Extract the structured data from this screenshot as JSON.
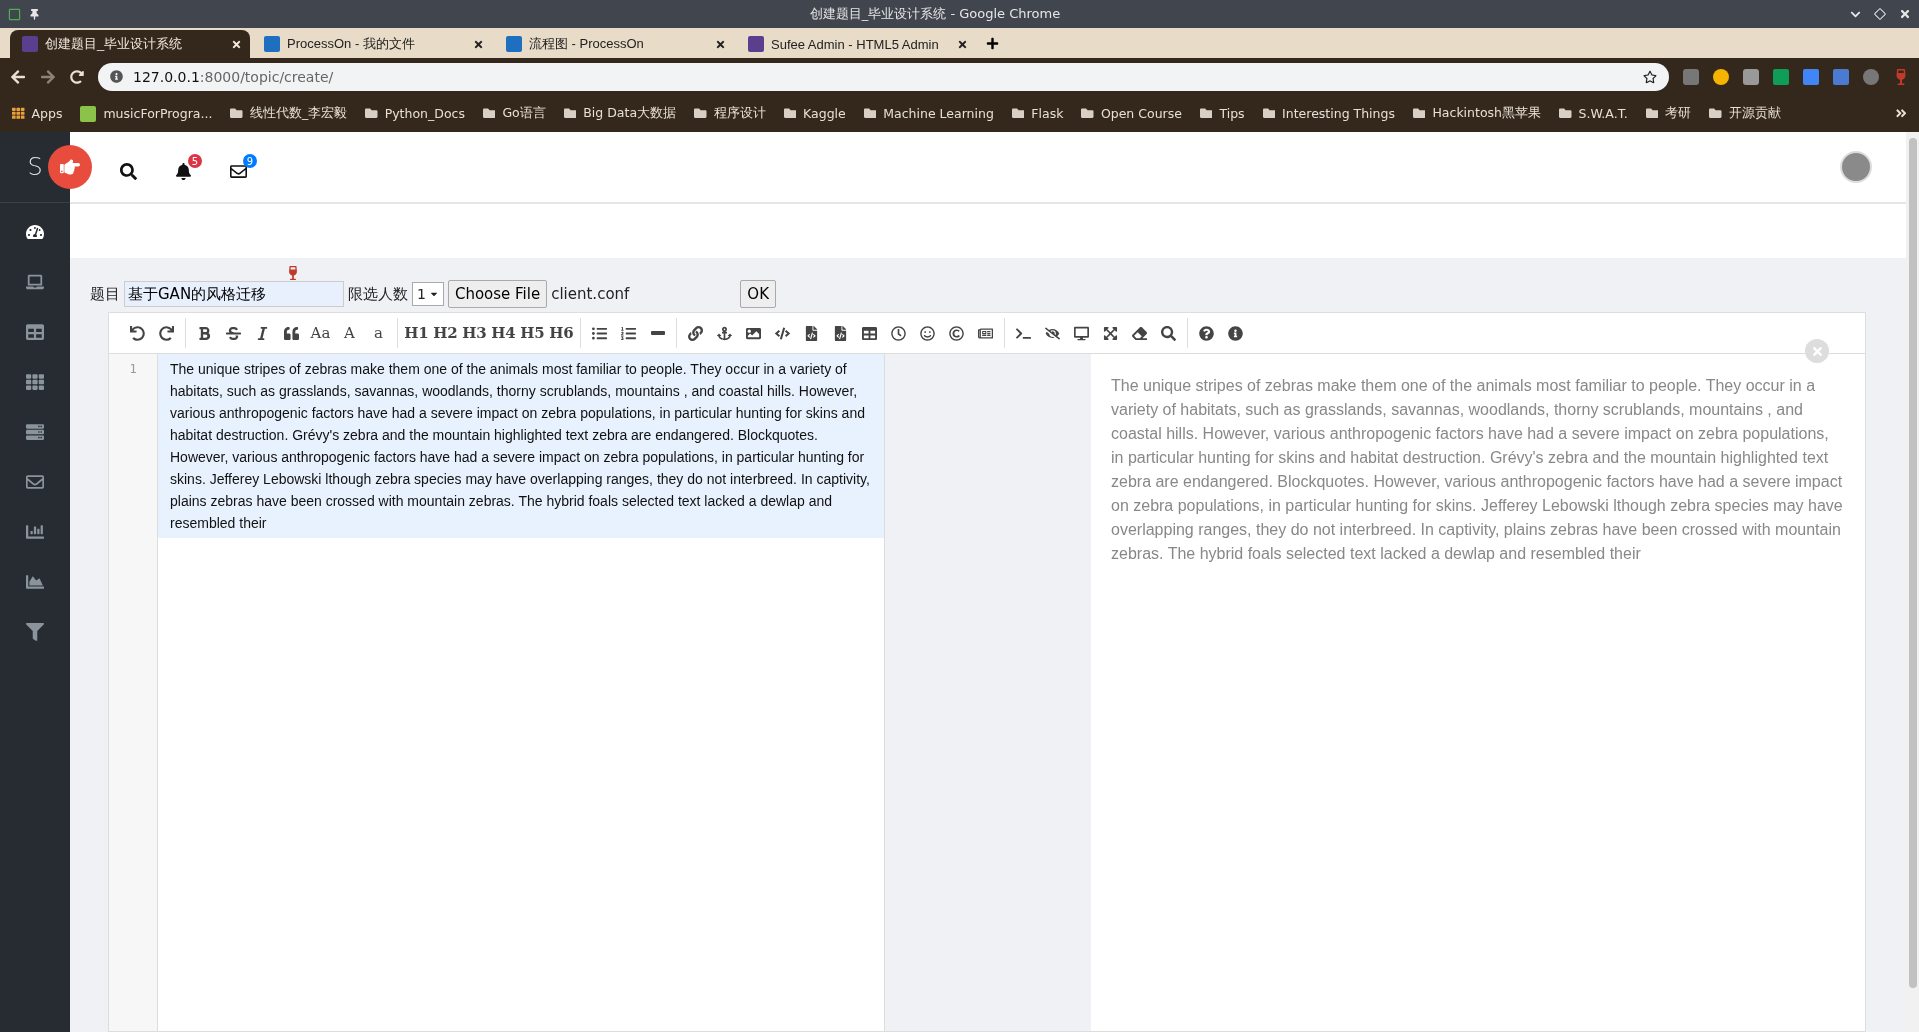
{
  "browser": {
    "title": "创建题目_毕业设计系统 - Google Chrome",
    "tabs": [
      {
        "title": "创建题目_毕业设计系统",
        "selected": true
      },
      {
        "title": "ProcessOn - 我的文件",
        "selected": false
      },
      {
        "title": "流程图 - ProcessOn",
        "selected": false
      },
      {
        "title": "Sufee Admin - HTML5 Admin",
        "selected": false
      }
    ],
    "address": {
      "host": "127.0.0.1",
      "rest": ":8000/topic/create/"
    },
    "bookmarks": [
      {
        "label": "Apps",
        "kind": "apps"
      },
      {
        "label": "musicForProgra...",
        "kind": "site"
      },
      {
        "label": "线性代数_李宏毅",
        "kind": "folder"
      },
      {
        "label": "Python_Docs",
        "kind": "folder"
      },
      {
        "label": "Go语言",
        "kind": "folder"
      },
      {
        "label": "Big Data大数据",
        "kind": "folder"
      },
      {
        "label": "程序设计",
        "kind": "folder"
      },
      {
        "label": "Kaggle",
        "kind": "folder"
      },
      {
        "label": "Machine Learning",
        "kind": "folder"
      },
      {
        "label": "Flask",
        "kind": "folder"
      },
      {
        "label": "Open Course",
        "kind": "folder"
      },
      {
        "label": "Tips",
        "kind": "folder"
      },
      {
        "label": "Interesting Things",
        "kind": "folder"
      },
      {
        "label": "Hackintosh黑苹果",
        "kind": "folder"
      },
      {
        "label": "S.W.A.T.",
        "kind": "folder"
      },
      {
        "label": "考研",
        "kind": "folder"
      },
      {
        "label": "开源贡献",
        "kind": "folder"
      }
    ]
  },
  "app": {
    "logo": "S",
    "notifications": "5",
    "messages": "9",
    "sidebar": {
      "items": [
        {
          "selected": true
        },
        {
          "selected": false
        },
        {
          "selected": false
        },
        {
          "selected": false
        },
        {
          "selected": false
        },
        {
          "selected": false
        },
        {
          "selected": false
        },
        {
          "selected": false
        },
        {
          "selected": false
        }
      ]
    },
    "form": {
      "title_label": "题目",
      "title_value": "基于GAN的风格迁移",
      "limit_label": "限选人数",
      "limit_value": "1",
      "file_button": "Choose File",
      "file_name": "client.conf",
      "ok_button": "OK"
    },
    "toolbar": {
      "text_buttons": [
        "Aa",
        "A",
        "a",
        "H1",
        "H2",
        "H3",
        "H4",
        "H5",
        "H6"
      ]
    },
    "editor": {
      "line_number": "1",
      "text": "The unique stripes of zebras make them one of the animals most familiar to people. They occur in a variety of habitats, such as grasslands, savannas, woodlands, thorny scrublands, mountains , and coastal hills. However, various anthropogenic factors have had a severe impact on zebra populations, in particular hunting for skins and habitat destruction. Grévy's zebra and the mountain highlighted text zebra are endangered. Blockquotes. However, various anthropogenic factors have had a severe impact on zebra populations, in particular hunting for skins. Jefferey Lebowski lthough zebra species may have overlapping ranges, they do not interbreed. In captivity, plains zebras have been crossed with mountain zebras. The hybrid foals selected text lacked a dewlap and resembled their"
    },
    "preview": {
      "text": "The unique stripes of zebras make them one of the animals most familiar to people. They occur in a variety of habitats, such as grasslands, savannas, woodlands, thorny scrublands, mountains , and coastal hills. However, various anthropogenic factors have had a severe impact on zebra populations, in particular hunting for skins and habitat destruction. Grévy's zebra and the mountain highlighted text zebra are endangered. Blockquotes. However, various anthropogenic factors have had a severe impact on zebra populations, in particular hunting for skins. Jefferey Lebowski lthough zebra species may have overlapping ranges, they do not interbreed. In captivity, plains zebras have been crossed with mountain zebras. The hybrid foals selected text lacked a dewlap and resembled their"
    }
  }
}
